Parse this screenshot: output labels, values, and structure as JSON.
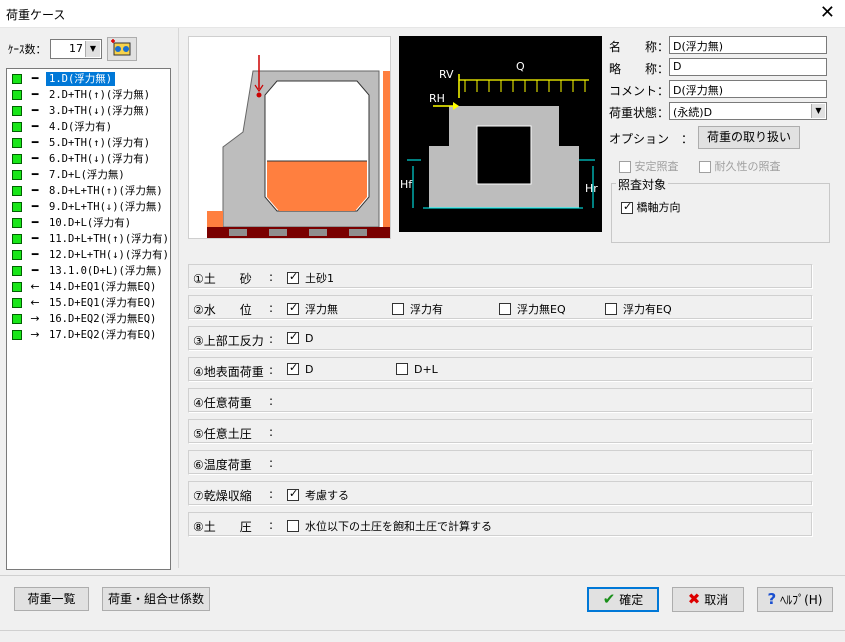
{
  "window": {
    "title": "荷重ケース",
    "close_glyph": "✕"
  },
  "case_count": {
    "label": "ｹｰｽ数：",
    "value": "17"
  },
  "cases": [
    {
      "marker": "━",
      "label": "1.D(浮力無)",
      "selected": true
    },
    {
      "marker": "━",
      "label": "2.D+TH(↑)(浮力無)"
    },
    {
      "marker": "━",
      "label": "3.D+TH(↓)(浮力無)"
    },
    {
      "marker": "━",
      "label": "4.D(浮力有)"
    },
    {
      "marker": "━",
      "label": "5.D+TH(↑)(浮力有)"
    },
    {
      "marker": "━",
      "label": "6.D+TH(↓)(浮力有)"
    },
    {
      "marker": "━",
      "label": "7.D+L(浮力無)"
    },
    {
      "marker": "━",
      "label": "8.D+L+TH(↑)(浮力無)"
    },
    {
      "marker": "━",
      "label": "9.D+L+TH(↓)(浮力無)"
    },
    {
      "marker": "━",
      "label": "10.D+L(浮力有)"
    },
    {
      "marker": "━",
      "label": "11.D+L+TH(↑)(浮力有)"
    },
    {
      "marker": "━",
      "label": "12.D+L+TH(↓)(浮力有)"
    },
    {
      "marker": "━",
      "label": "13.1.0(D+L)(浮力無)"
    },
    {
      "marker": "←",
      "label": "14.D+EQ1(浮力無EQ)"
    },
    {
      "marker": "←",
      "label": "15.D+EQ1(浮力有EQ)"
    },
    {
      "marker": "→",
      "label": "16.D+EQ2(浮力無EQ)"
    },
    {
      "marker": "→",
      "label": "17.D+EQ2(浮力有EQ)"
    }
  ],
  "diagram": {
    "labels": {
      "rv": "RV",
      "q": "Q",
      "rh": "RH",
      "hf": "Hf",
      "hr": "Hr"
    }
  },
  "props": {
    "name_label": "名　　称：",
    "name_value": "D(浮力無)",
    "abbr_label": "略　　称：",
    "abbr_value": "D",
    "comment_label": "コメント：",
    "comment_value": "D(浮力無)",
    "state_label": "荷重状態：",
    "state_value": "(永続)D",
    "option_label": "オプション　：",
    "option_button": "荷重の取り扱い",
    "stability_label": "安定照査",
    "durability_label": "耐久性の照査",
    "target_group": "照査対象",
    "target_axis_label": "橋軸方向"
  },
  "rows": [
    {
      "label": "①土　　砂",
      "options": [
        {
          "label": "土砂1",
          "checked": true
        }
      ]
    },
    {
      "label": "②水　　位",
      "options": [
        {
          "label": "浮力無",
          "checked": true
        },
        {
          "label": "浮力有",
          "checked": false
        },
        {
          "label": "浮力無EQ",
          "checked": false
        },
        {
          "label": "浮力有EQ",
          "checked": false
        }
      ]
    },
    {
      "label": "③上部工反力",
      "options": [
        {
          "label": "D",
          "checked": true
        }
      ]
    },
    {
      "label": "④地表面荷重",
      "options": [
        {
          "label": "D",
          "checked": true
        },
        {
          "label": "D+L",
          "checked": false
        }
      ]
    },
    {
      "label": "④任意荷重",
      "options": []
    },
    {
      "label": "⑤任意土圧",
      "options": []
    },
    {
      "label": "⑥温度荷重",
      "options": []
    },
    {
      "label": "⑦乾燥収縮",
      "options": [
        {
          "label": "考慮する",
          "checked": true
        }
      ]
    },
    {
      "label": "⑧土　　圧",
      "options": [
        {
          "label": "水位以下の土圧を飽和土圧で計算する",
          "checked": false
        }
      ]
    }
  ],
  "buttons": {
    "load_list": "荷重一覧",
    "load_combo": "荷重・組合せ係数",
    "ok": "確定",
    "cancel": "取消",
    "help": "ﾍﾙﾌﾟ(H)"
  },
  "colors": {
    "fill_orange": "#ff7f3f",
    "selected": "#0078d7",
    "case_green": "#19e619"
  }
}
